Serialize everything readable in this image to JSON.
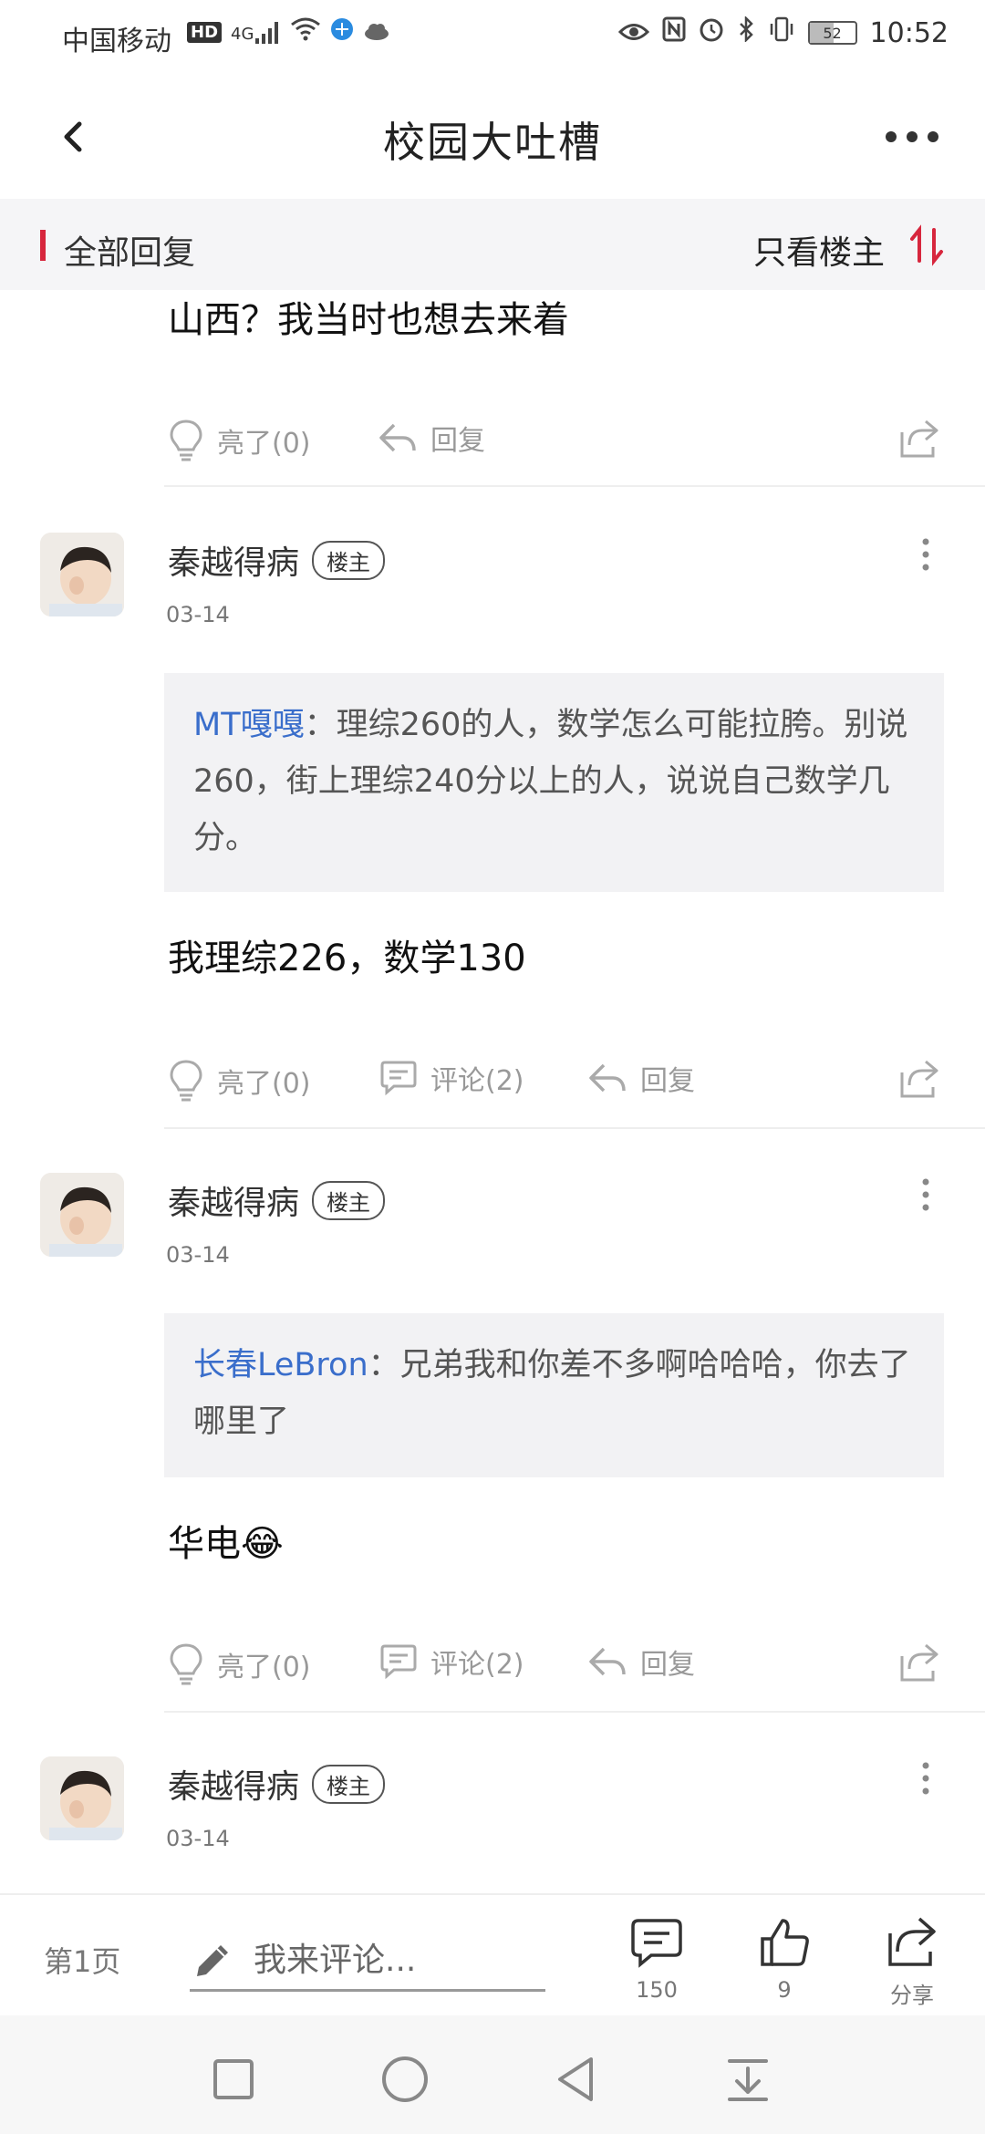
{
  "status_bar": {
    "carrier": "中国移动",
    "hd": "HD",
    "network": "4G",
    "battery": "52",
    "time": "10:52"
  },
  "header": {
    "title": "校园大吐槽"
  },
  "filter_bar": {
    "all_replies": "全部回复",
    "only_owner": "只看楼主"
  },
  "partial_post": {
    "text": "山西？我当时也想去来着",
    "like_label": "亮了(0)",
    "reply_label": "回复"
  },
  "posts": [
    {
      "username": "秦越得病",
      "badge": "楼主",
      "date": "03-14",
      "quote_name": "MT嘎嘎",
      "quote_text": "：理综260的人，数学怎么可能拉胯。别说260，街上理综240分以上的人，说说自己数学几分。",
      "body": "我理综226，数学130",
      "like_label": "亮了(0)",
      "comment_label": "评论(2)",
      "reply_label": "回复"
    },
    {
      "username": "秦越得病",
      "badge": "楼主",
      "date": "03-14",
      "quote_name": "长春LeBron",
      "quote_text": "：兄弟我和你差不多啊哈哈哈，你去了哪里了",
      "body": "华电😂",
      "like_label": "亮了(0)",
      "comment_label": "评论(2)",
      "reply_label": "回复"
    },
    {
      "username": "秦越得病",
      "badge": "楼主",
      "date": "03-14"
    }
  ],
  "bottom_bar": {
    "page_label": "第1页",
    "comment_placeholder": "我来评论...",
    "comment_count": "150",
    "like_count": "9",
    "share_label": "分享"
  },
  "colors": {
    "accent_red": "#d7263d",
    "quote_name_blue": "#3a6ecb"
  }
}
